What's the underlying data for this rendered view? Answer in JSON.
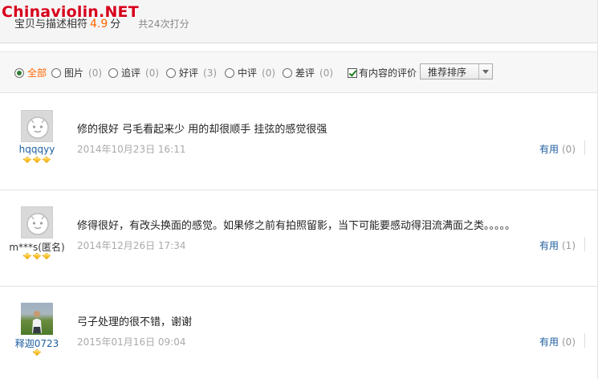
{
  "watermark": "Chinaviolin.NET",
  "summary": {
    "label": "宝贝与描述相符",
    "score": "4.9",
    "unit": "分",
    "total": "共24次打分"
  },
  "filters": [
    {
      "label": "全部",
      "count": "",
      "selected": true
    },
    {
      "label": "图片",
      "count": "(0)",
      "selected": false
    },
    {
      "label": "追评",
      "count": "(0)",
      "selected": false
    },
    {
      "label": "好评",
      "count": "(3)",
      "selected": false
    },
    {
      "label": "中评",
      "count": "(0)",
      "selected": false
    },
    {
      "label": "差评",
      "count": "(0)",
      "selected": false
    }
  ],
  "has_content": {
    "label": "有内容的评价",
    "checked": true
  },
  "sort": {
    "selected": "推荐排序"
  },
  "reviews": [
    {
      "nickname": "hqqqyy",
      "stars": 3,
      "content": "修的很好 弓毛看起来少 用的却很顺手 挂弦的感觉很强",
      "date": "2014年10月23日 16:11",
      "useful_label": "有用",
      "useful_count": "(0)",
      "avatar": "default-avatar"
    },
    {
      "nickname": "m***s(匿名)",
      "stars": 3,
      "content": "修得很好，有改头换面的感觉。如果修之前有拍照留影，当下可能要感动得泪流满面之类。。。。。",
      "date": "2014年12月26日 17:34",
      "useful_label": "有用",
      "useful_count": "(1)",
      "avatar": "default-avatar"
    },
    {
      "nickname": "释迦0723",
      "stars": 1,
      "content": "弓子处理的很不错，谢谢",
      "date": "2015年01月16日 09:04",
      "useful_label": "有用",
      "useful_count": "(0)",
      "avatar": "photo-avatar"
    }
  ],
  "colors": {
    "accent": "#ff6600",
    "link": "#1f5fa0"
  }
}
